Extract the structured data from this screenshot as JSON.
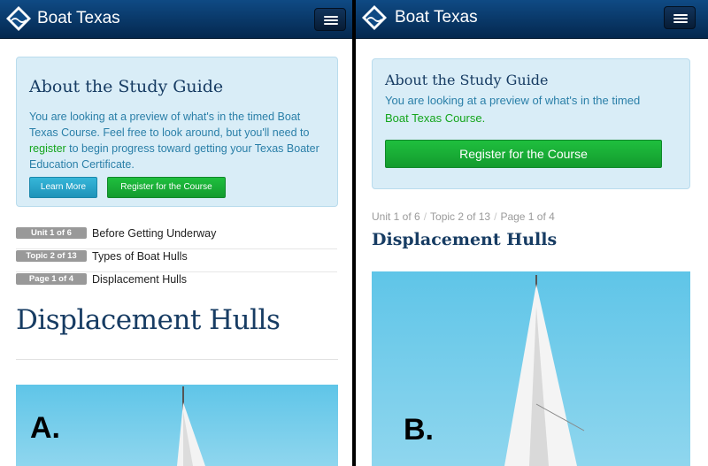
{
  "app": {
    "brand": "Boat Texas"
  },
  "variant_a": {
    "well": {
      "title": "About the Study Guide",
      "text_before": "You are looking at a preview of what's in the timed Boat Texas Course. Feel free to look around, but you'll need to ",
      "register_link": "register",
      "text_after": " to begin progress toward getting your Texas Boater Education Certificate.",
      "learn_more_button": "Learn More",
      "register_button": "Register for the Course"
    },
    "breadcrumbs": [
      {
        "badge": "Unit 1 of 6",
        "label": "Before Getting Underway"
      },
      {
        "badge": "Topic 2 of 13",
        "label": "Types of Boat Hulls"
      },
      {
        "badge": "Page 1 of 4",
        "label": "Displacement Hulls"
      }
    ],
    "page_title": "Displacement Hulls",
    "image_label": "A."
  },
  "variant_b": {
    "well": {
      "title": "About the Study Guide",
      "text": "You are looking at a preview of what's in the timed",
      "course_link": "Boat Texas Course.",
      "register_button": "Register for the Course"
    },
    "breadcrumb": {
      "unit": "Unit 1 of 6",
      "topic": "Topic 2 of 13",
      "page": "Page 1 of 4",
      "separator": "/"
    },
    "page_title": "Displacement Hulls",
    "image_label": "B."
  },
  "colors": {
    "navbar": "#0a3a6b",
    "well_bg": "#d9edf7",
    "success": "#1cb53a",
    "info": "#2aa7cc",
    "title": "#173c63"
  }
}
